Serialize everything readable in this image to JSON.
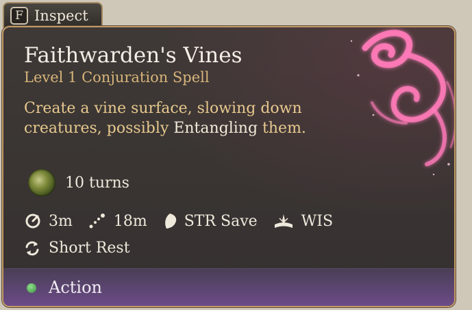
{
  "inspect": {
    "key": "F",
    "label": "Inspect"
  },
  "spell": {
    "name": "Faithwarden's Vines",
    "subtitle": "Level 1 Conjuration Spell",
    "description_part1": "Create a vine surface, slowing down creatures, possibly ",
    "description_keyword": "Entangling",
    "description_part2": " them."
  },
  "duration": {
    "icon": "vine-surface-icon",
    "text": "10 turns"
  },
  "stats": [
    {
      "icon": "aoe-radius-icon",
      "text": "3m"
    },
    {
      "icon": "range-icon",
      "text": "18m"
    },
    {
      "icon": "saving-throw-icon",
      "text": "STR Save"
    },
    {
      "icon": "spellcasting-ability-icon",
      "text": "WIS"
    }
  ],
  "recharge": {
    "icon": "short-rest-icon",
    "text": "Short Rest"
  },
  "cost": {
    "icon": "action-dot-icon",
    "text": "Action",
    "color": "#3e8f43"
  },
  "colors": {
    "border": "#c39a67",
    "subtitle": "#d9b57a",
    "description": "#e7c98e",
    "action_bar": "#6c4b88",
    "spiral": "#ff7ab8"
  }
}
